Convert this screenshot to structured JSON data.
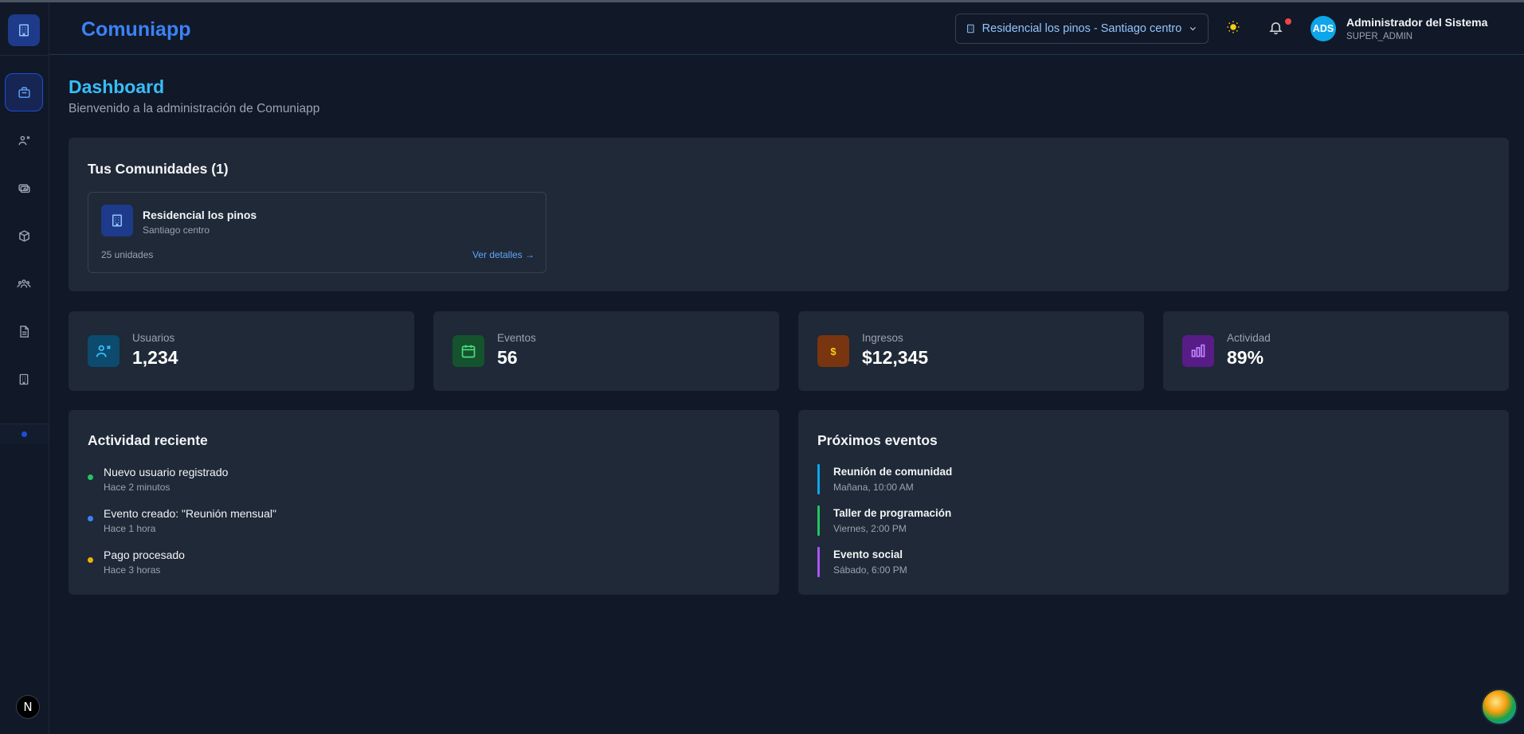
{
  "header": {
    "brand": "Comuniapp",
    "community_selector": "Residencial los pinos - Santiago centro",
    "user": {
      "initials": "ADS",
      "name": "Administrador del Sistema",
      "role": "SUPER_ADMIN"
    }
  },
  "sidebar": {
    "items": [
      {
        "icon": "dashboard-icon",
        "active": true
      },
      {
        "icon": "users-icon",
        "active": false
      },
      {
        "icon": "payments-icon",
        "active": false
      },
      {
        "icon": "box-icon",
        "active": false
      },
      {
        "icon": "groups-icon",
        "active": false
      },
      {
        "icon": "document-icon",
        "active": false
      },
      {
        "icon": "building-icon",
        "active": false
      }
    ],
    "footer_badge": "N"
  },
  "page": {
    "title": "Dashboard",
    "subtitle": "Bienvenido a la administración de Comuniapp"
  },
  "communities": {
    "title": "Tus Comunidades (1)",
    "items": [
      {
        "name": "Residencial los pinos",
        "location": "Santiago centro",
        "units": "25 unidades",
        "link": "Ver detalles →"
      }
    ]
  },
  "stats": [
    {
      "label": "Usuarios",
      "value": "1,234",
      "icon": "users-icon",
      "color": "#38bdf8",
      "bg": "#0c4a6e"
    },
    {
      "label": "Eventos",
      "value": "56",
      "icon": "calendar-icon",
      "color": "#4ade80",
      "bg": "#14532d"
    },
    {
      "label": "Ingresos",
      "value": "$12,345",
      "icon": "dollar-icon",
      "color": "#facc15",
      "bg": "#78350f"
    },
    {
      "label": "Actividad",
      "value": "89%",
      "icon": "bar-chart-icon",
      "color": "#c084fc",
      "bg": "#581c87"
    }
  ],
  "recent_activity": {
    "title": "Actividad reciente",
    "items": [
      {
        "text": "Nuevo usuario registrado",
        "time": "Hace 2 minutos",
        "color": "#22c55e"
      },
      {
        "text": "Evento creado: \"Reunión mensual\"",
        "time": "Hace 1 hora",
        "color": "#3b82f6"
      },
      {
        "text": "Pago procesado",
        "time": "Hace 3 horas",
        "color": "#eab308"
      }
    ]
  },
  "upcoming_events": {
    "title": "Próximos eventos",
    "items": [
      {
        "title": "Reunión de comunidad",
        "time": "Mañana, 10:00 AM",
        "color": "#0ea5e9"
      },
      {
        "title": "Taller de programación",
        "time": "Viernes, 2:00 PM",
        "color": "#22c55e"
      },
      {
        "title": "Evento social",
        "time": "Sábado, 6:00 PM",
        "color": "#a855f7"
      }
    ]
  }
}
